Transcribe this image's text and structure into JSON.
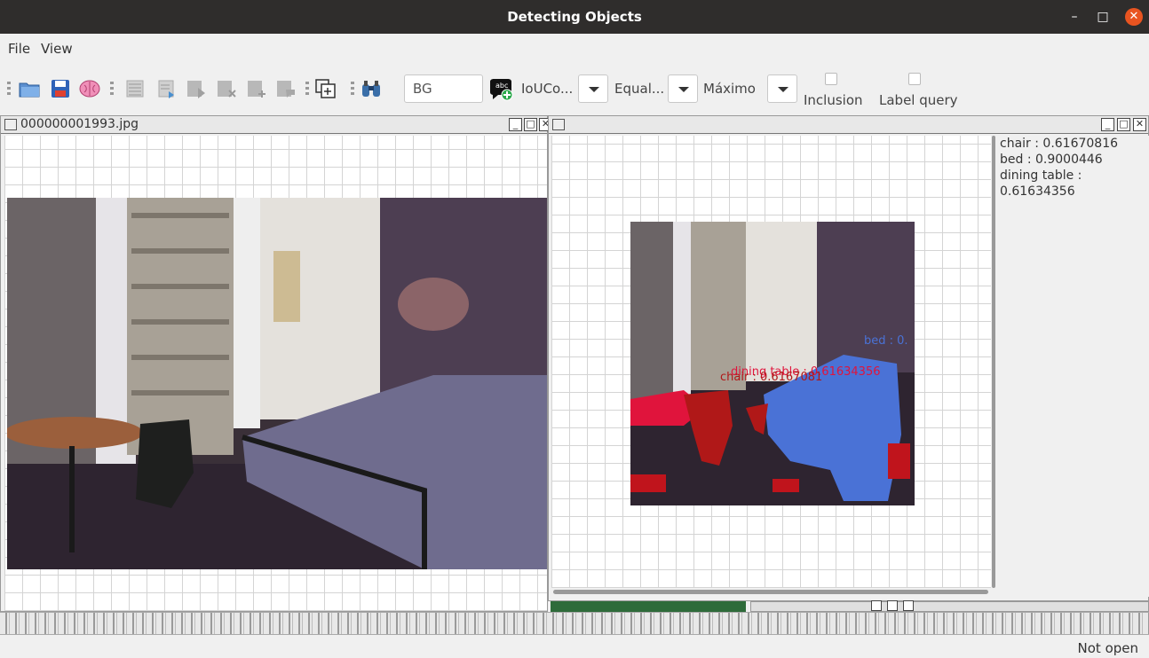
{
  "window": {
    "title": "Detecting Objects"
  },
  "menu": {
    "file": "File",
    "view": "View"
  },
  "toolbar": {
    "label_input": "BG",
    "iou_combo": "IoUCo...",
    "equal_combo": "Equal...",
    "max_combo": "Máximo",
    "inclusion_label": "Inclusion",
    "label_query_label": "Label query",
    "icons": [
      "open-folder-icon",
      "save-icon",
      "brain-icon",
      "list-icon",
      "export-icon",
      "arrow-icon",
      "delete-icon",
      "add-icon",
      "comment-icon",
      "copy-add-icon",
      "binoculars-icon",
      "add-label-icon"
    ]
  },
  "left_window": {
    "title": "000000001993.jpg"
  },
  "right_window": {
    "title": "",
    "overlay_labels": {
      "bed": "bed : 0.",
      "dining_table": "dining table : 0.61634356",
      "chair": "chair : 0.6167081"
    },
    "results": [
      "chair : 0.61670816",
      "bed : 0.9000446",
      "dining table : 0.61634356"
    ]
  },
  "colors": {
    "chair": "#b01818",
    "dining_table": "#e0143c",
    "bed": "#4a72d6"
  },
  "status": {
    "text": "Not open"
  }
}
